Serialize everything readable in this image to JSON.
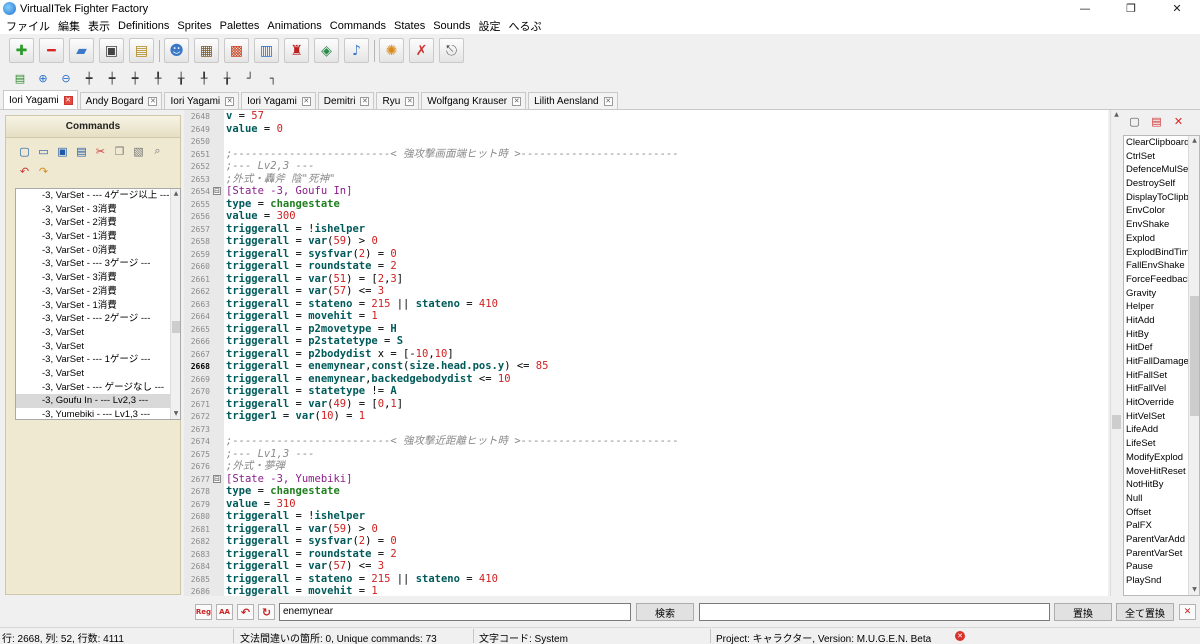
{
  "window": {
    "title": "VirtualITek Fighter Factory",
    "controls": [
      "—",
      "❐",
      "✕"
    ]
  },
  "menu": [
    "ファイル",
    "編集",
    "表示",
    "Definitions",
    "Sprites",
    "Palettes",
    "Animations",
    "Commands",
    "States",
    "Sounds",
    "設定",
    "へるぷ"
  ],
  "tabs": [
    {
      "label": "Iori Yagami",
      "active": true
    },
    {
      "label": "Andy Bogard",
      "active": false
    },
    {
      "label": "Iori Yagami",
      "active": false
    },
    {
      "label": "Iori Yagami",
      "active": false
    },
    {
      "label": "Demitri",
      "active": false
    },
    {
      "label": "Ryu",
      "active": false
    },
    {
      "label": "Wolfgang Krauser",
      "active": false
    },
    {
      "label": "Lilith Aensland",
      "active": false
    }
  ],
  "left_panel": {
    "title": "Commands",
    "items": [
      "-3, VarSet - --- 4ゲージ以上 ---",
      "-3, VarSet - 3消費",
      "-3, VarSet - 2消費",
      "-3, VarSet - 1消費",
      "-3, VarSet - 0消費",
      "-3, VarSet - --- 3ゲージ ---",
      "-3, VarSet - 3消費",
      "-3, VarSet - 2消費",
      "-3, VarSet - 1消費",
      "-3, VarSet - --- 2ゲージ ---",
      "-3, VarSet",
      "-3, VarSet",
      "-3, VarSet - --- 1ゲージ ---",
      "-3, VarSet",
      "-3, VarSet - --- ゲージなし ---",
      "-3, Goufu In - --- Lv2,3 ---",
      "-3, Yumebiki - --- Lv1,3 ---"
    ],
    "selected_index": 15
  },
  "editor": {
    "current_line": "2668",
    "lines": [
      {
        "n": "2648",
        "t": "v = 57"
      },
      {
        "n": "2649",
        "t": "value = 0"
      },
      {
        "n": "2650",
        "t": ""
      },
      {
        "n": "2651",
        "t": ";-------------------------< 強攻撃画面端ヒット時 >-------------------------"
      },
      {
        "n": "2652",
        "t": ";--- Lv2,3 ---"
      },
      {
        "n": "2653",
        "t": ";外式・轟斧 陰\"死神\""
      },
      {
        "n": "2654",
        "t": "[State -3, Goufu In]",
        "fold": true
      },
      {
        "n": "2655",
        "t": "type = changestate"
      },
      {
        "n": "2656",
        "t": "value = 300"
      },
      {
        "n": "2657",
        "t": "triggerall = !ishelper"
      },
      {
        "n": "2658",
        "t": "triggerall = var(59) > 0"
      },
      {
        "n": "2659",
        "t": "triggerall = sysfvar(2) = 0"
      },
      {
        "n": "2660",
        "t": "triggerall = roundstate = 2"
      },
      {
        "n": "2661",
        "t": "triggerall = var(51) = [2,3]"
      },
      {
        "n": "2662",
        "t": "triggerall = var(57) <= 3"
      },
      {
        "n": "2663",
        "t": "triggerall = stateno = 215 || stateno = 410"
      },
      {
        "n": "2664",
        "t": "triggerall = movehit = 1"
      },
      {
        "n": "2665",
        "t": "triggerall = p2movetype = H"
      },
      {
        "n": "2666",
        "t": "triggerall = p2statetype = S"
      },
      {
        "n": "2667",
        "t": "triggerall = p2bodydist x = [-10,10]"
      },
      {
        "n": "2668",
        "t": "triggerall = enemynear,const(size.head.pos.y) <= 85"
      },
      {
        "n": "2669",
        "t": "triggerall = enemynear,backedgebodydist <= 10"
      },
      {
        "n": "2670",
        "t": "triggerall = statetype != A"
      },
      {
        "n": "2671",
        "t": "triggerall = var(49) = [0,1]"
      },
      {
        "n": "2672",
        "t": "trigger1 = var(10) = 1"
      },
      {
        "n": "2673",
        "t": ""
      },
      {
        "n": "2674",
        "t": ";-------------------------< 強攻撃近距離ヒット時 >-------------------------"
      },
      {
        "n": "2675",
        "t": ";--- Lv1,3 ---"
      },
      {
        "n": "2676",
        "t": ";外式・夢弾"
      },
      {
        "n": "2677",
        "t": "[State -3, Yumebiki]",
        "fold": true
      },
      {
        "n": "2678",
        "t": "type = changestate"
      },
      {
        "n": "2679",
        "t": "value = 310"
      },
      {
        "n": "2680",
        "t": "triggerall = !ishelper"
      },
      {
        "n": "2681",
        "t": "triggerall = var(59) > 0"
      },
      {
        "n": "2682",
        "t": "triggerall = sysfvar(2) = 0"
      },
      {
        "n": "2683",
        "t": "triggerall = roundstate = 2"
      },
      {
        "n": "2684",
        "t": "triggerall = var(57) <= 3"
      },
      {
        "n": "2685",
        "t": "triggerall = stateno = 215 || stateno = 410"
      },
      {
        "n": "2686",
        "t": "triggerall = movehit = 1"
      }
    ]
  },
  "right_panel": {
    "items": [
      "ClearClipboard",
      "CtrlSet",
      "DefenceMulSet",
      "DestroySelf",
      "DisplayToClipboard",
      "EnvColor",
      "EnvShake",
      "Explod",
      "ExplodBindTime",
      "FallEnvShake",
      "ForceFeedback",
      "Gravity",
      "Helper",
      "HitAdd",
      "HitBy",
      "HitDef",
      "HitFallDamage",
      "HitFallSet",
      "HitFallVel",
      "HitOverride",
      "HitVelSet",
      "LifeAdd",
      "LifeSet",
      "ModifyExplod",
      "MoveHitReset",
      "NotHitBy",
      "Null",
      "Offset",
      "PalFX",
      "ParentVarAdd",
      "ParentVarSet",
      "Pause",
      "PlaySnd"
    ]
  },
  "find_bar": {
    "regex_label": "Reg",
    "case_label": "AA",
    "search_value": "enemynear",
    "search_button": "検索",
    "replace_value": "",
    "replace_button": "置換",
    "replace_all_button": "全て置換",
    "close": "✕"
  },
  "status": {
    "position": "行: 2668, 列: 52, 行数: 4111",
    "errors": "文法間違いの箇所: 0, Unique commands: 73",
    "encoding": "文字コード: System",
    "project": "Project: キャラクター, Version: M.U.G.E.N. Beta"
  },
  "icons": {
    "toolbar1": [
      "new-character-icon",
      "close-character-icon",
      "open-folder-icon",
      "save-icon",
      "save-all-icon",
      "characters-icon",
      "definitions-icon",
      "sprites-icon",
      "palettes-icon",
      "animations-icon",
      "commands-joystick-icon",
      "states-icon",
      "sounds-icon",
      "paint-palette-icon",
      "tools-icon",
      "exit-icon"
    ],
    "toolbar2": [
      "calculator-icon",
      "zoom-in-icon",
      "zoom-out-icon",
      "insert-1-icon",
      "insert-2-icon",
      "insert-3-icon",
      "insert-4-icon",
      "insert-5-icon",
      "insert-6-icon",
      "insert-7-icon",
      "insert-8-icon",
      "insert-9-icon"
    ]
  }
}
